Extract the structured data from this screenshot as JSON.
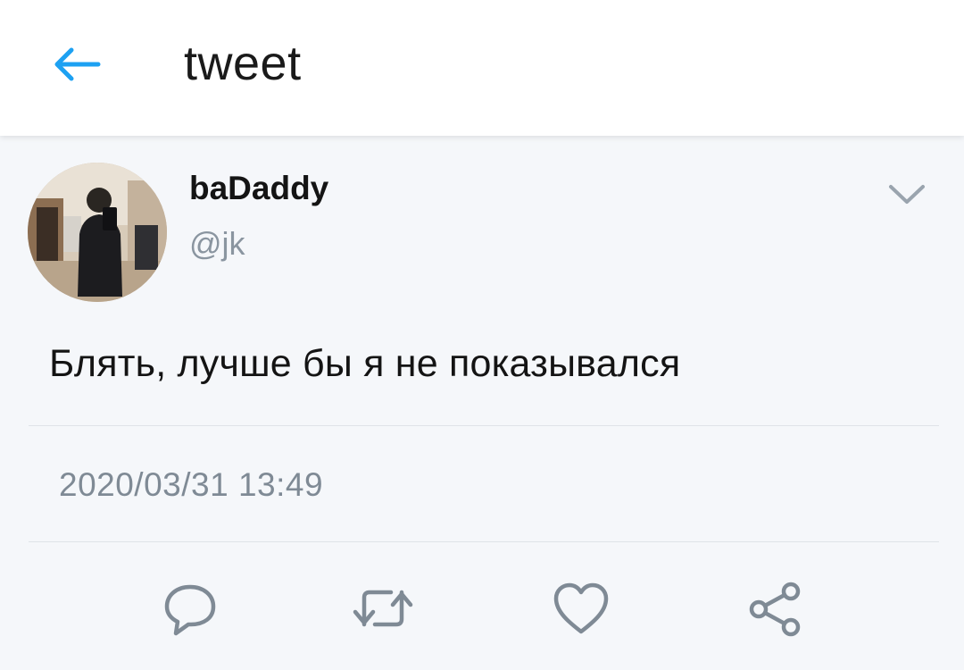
{
  "header": {
    "title": "tweet",
    "back_icon": "arrow-left-icon"
  },
  "tweet": {
    "display_name": "baDaddy",
    "handle": "@jk",
    "text": "Блять, лучше бы я не показывался",
    "timestamp": "2020/03/31 13:49"
  },
  "actions": [
    {
      "icon": "reply-icon"
    },
    {
      "icon": "retweet-icon"
    },
    {
      "icon": "like-icon"
    },
    {
      "icon": "share-icon"
    }
  ],
  "colors": {
    "accent": "#1da1f2",
    "icon_gray": "#7f8a95",
    "handle_gray": "#8a95a0",
    "background": "#f5f7fa",
    "header_bg": "#ffffff"
  }
}
